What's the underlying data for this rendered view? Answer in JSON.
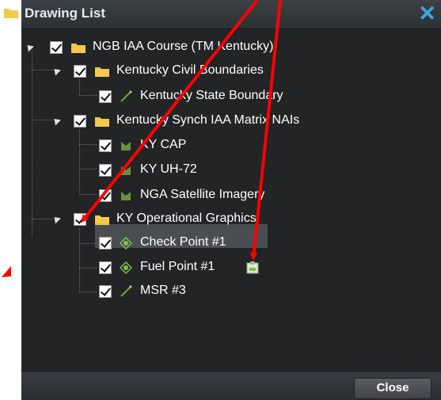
{
  "window": {
    "title": "Drawing List",
    "close_button_label": "Close"
  },
  "tree": {
    "root": {
      "label": "NGB IAA Course (TM Kentucky)",
      "checked": true
    },
    "groups": [
      {
        "label": "Kentucky Civil Boundaries",
        "checked": true,
        "items": [
          {
            "label": "Kentucky State Boundary",
            "checked": true,
            "icon": "line-icon"
          }
        ]
      },
      {
        "label": "Kentucky Synch IAA Matrix NAIs",
        "checked": true,
        "items": [
          {
            "label": "KY CAP",
            "checked": true,
            "icon": "area-icon"
          },
          {
            "label": "KY UH-72",
            "checked": true,
            "icon": "area-icon"
          },
          {
            "label": "NGA Satellite Imagery",
            "checked": true,
            "icon": "area-icon"
          }
        ]
      },
      {
        "label": "KY Operational Graphics",
        "checked": true,
        "items": [
          {
            "label": "Check Point #1",
            "checked": true,
            "icon": "point-icon"
          },
          {
            "label": "Fuel Point #1",
            "checked": true,
            "icon": "point-icon",
            "selected": true,
            "trailing_icon": "clipboard-icon"
          },
          {
            "label": "MSR #3",
            "checked": true,
            "icon": "line-icon"
          }
        ]
      }
    ]
  },
  "colors": {
    "accent_blue": "#3aa8e8",
    "folder_yellow": "#f2c94c",
    "annotation_red": "#ff0000"
  }
}
